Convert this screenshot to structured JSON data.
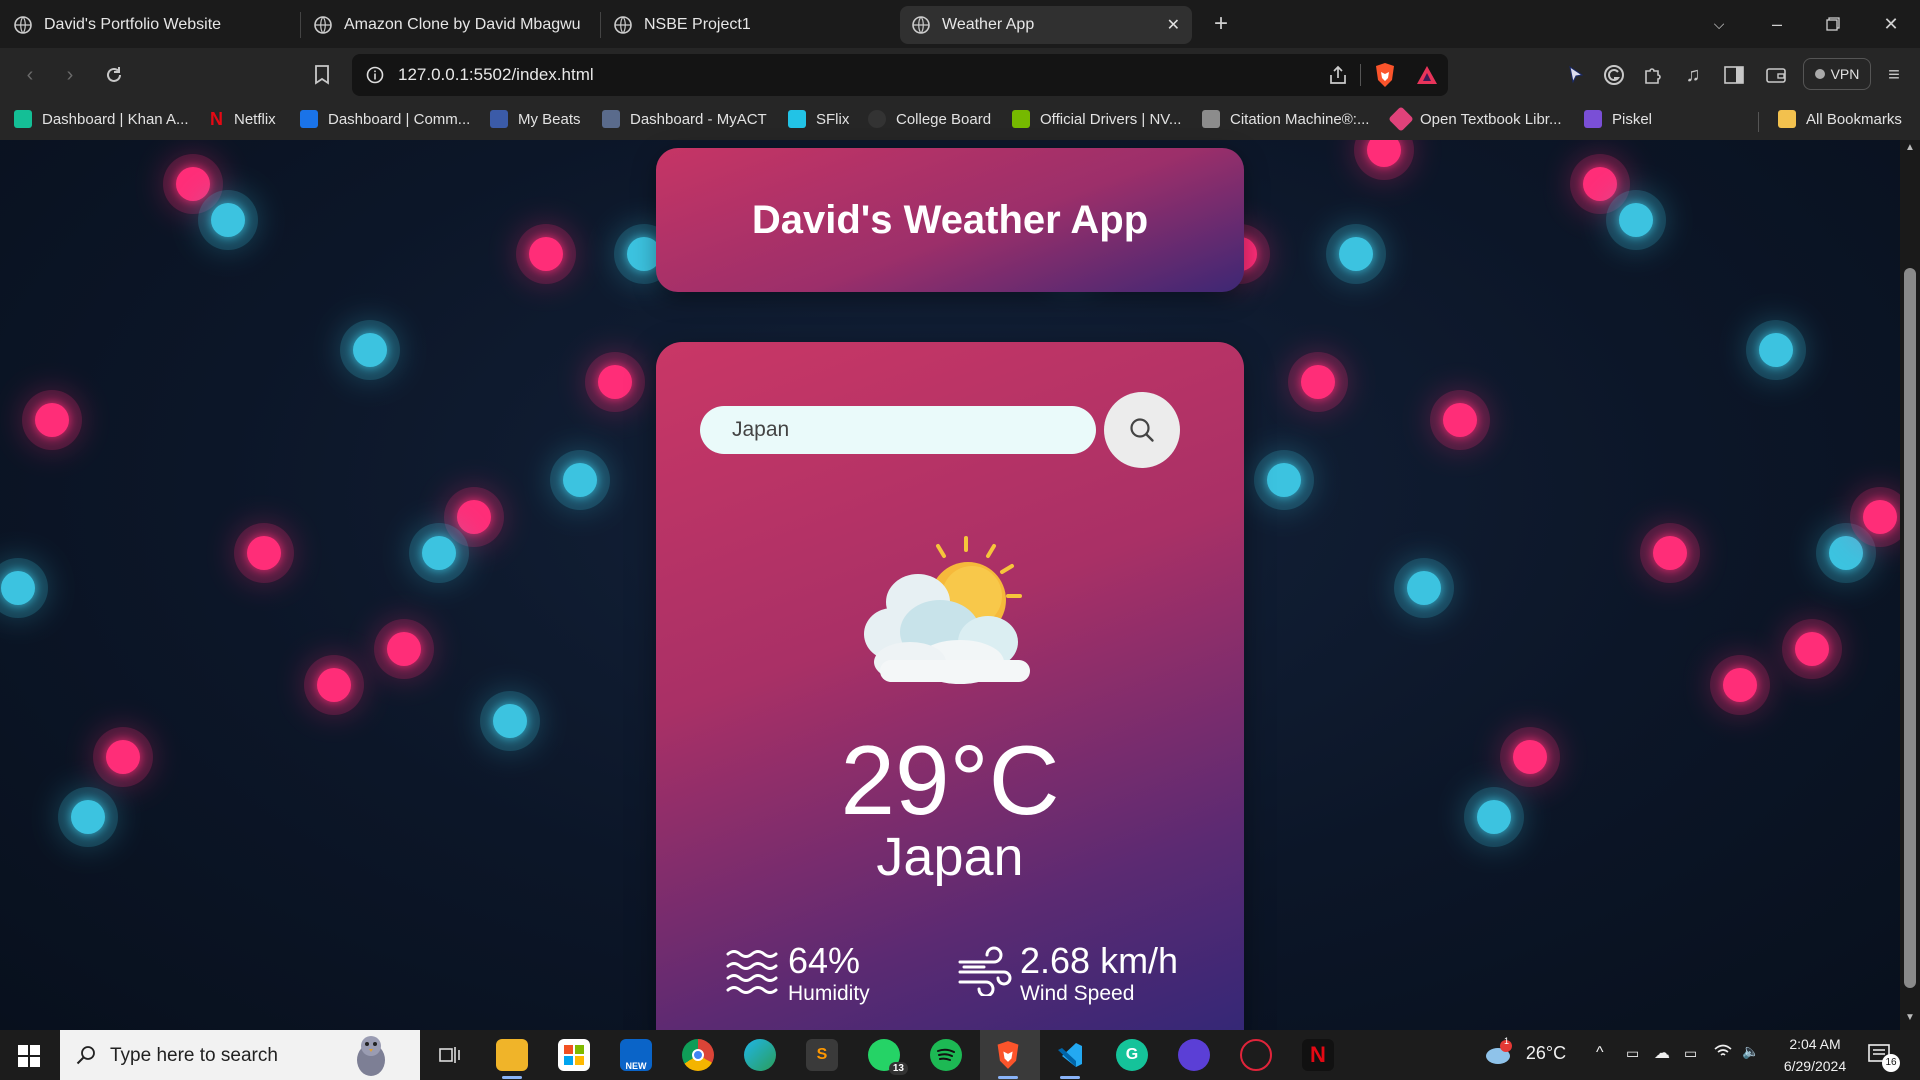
{
  "browser": {
    "tabs": [
      {
        "label": "David's Portfolio Website",
        "active": false
      },
      {
        "label": "Amazon Clone by David Mbagwu",
        "active": false
      },
      {
        "label": "NSBE Project1",
        "active": false
      },
      {
        "label": "Weather App",
        "active": true
      }
    ],
    "url": "127.0.0.1:5502/index.html",
    "vpn_label": "VPN",
    "bookmarks": [
      {
        "label": "Dashboard | Khan A...",
        "color": "#14bf96"
      },
      {
        "label": "Netflix",
        "color": "#e50914"
      },
      {
        "label": "Dashboard | Comm...",
        "color": "#1a73e8"
      },
      {
        "label": "My Beats",
        "color": "#3b5ba8"
      },
      {
        "label": "Dashboard - MyACT",
        "color": "#5a6b8c"
      },
      {
        "label": "SFlix",
        "color": "#22c3e6"
      },
      {
        "label": "College Board",
        "color": "#333333"
      },
      {
        "label": "Official Drivers | NV...",
        "color": "#76b900"
      },
      {
        "label": "Citation Machine®:...",
        "color": "#8c8c8c"
      },
      {
        "label": "Open Textbook Libr...",
        "color": "#e0427a"
      },
      {
        "label": "Piskel",
        "color": "#7a4fd6"
      }
    ],
    "all_bookmarks_label": "All Bookmarks"
  },
  "app": {
    "title": "David's Weather App",
    "search": {
      "value": "Japan"
    },
    "temperature": "29°C",
    "city": "Japan",
    "humidity": {
      "value": "64%",
      "label": "Humidity"
    },
    "wind": {
      "value": "2.68 km/h",
      "label": "Wind Speed"
    },
    "weather_icon": "sun-behind-clouds-icon"
  },
  "taskbar": {
    "search_placeholder": "Type here to search",
    "weather_temp": "26°C",
    "time": "2:04 AM",
    "date": "6/29/2024",
    "whatsapp_badge": "13",
    "notification_count": "16",
    "outlook_badge": "NEW",
    "weather_alert_badge": "1"
  },
  "colors": {
    "pink_dot": "#ff2d78",
    "blue_dot": "#3cc3e0",
    "card_top": "#c93766",
    "card_bottom": "#2f2777"
  }
}
